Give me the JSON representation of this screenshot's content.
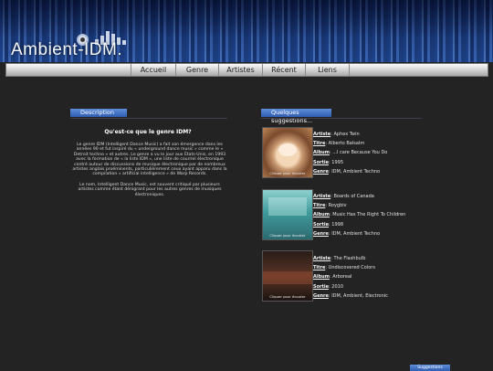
{
  "site": {
    "logo_text": "Ambient-IDM."
  },
  "nav": {
    "items": [
      "Accueil",
      "Genre",
      "Artistes",
      "Récent",
      "Liens"
    ]
  },
  "description": {
    "header": "Description",
    "question": "Qu'est-ce que le genre IDM?",
    "paragraphs": [
      "Le genre IDM (Intelligent Dance Music) a fait son émergence dans les années 90 et fut inspiré du « underground dance music » comme le « Detroit techno » et autres. Le genre a vu le jour aux États-Unis, en 1993 avec la formation de « la liste IDM », une liste de courriel électronique centré autour de discussions de musique électronique par de nombreux artistes anglais proéminents, particulièrement ceux ayant apparu dans la compilation « artificial intelligence » de Warp Records.",
      "Le nom, Intelligent Dance Music, est souvent critiqué par plusieurs artistes comme étant dénigrant pour les autres genres de musiques électroniques."
    ]
  },
  "suggestions": {
    "header": "Quelques suggestions...",
    "labels": {
      "artist": "Artiste",
      "title": "Titre",
      "album": "Album",
      "year": "Sortie",
      "genre": "Genre"
    },
    "items": [
      {
        "artist": "Aphex Twin",
        "title": "Alberto Balsalm",
        "album": "...I care Because You Do",
        "year": "1995",
        "genre": "IDM, Ambient Techno",
        "cover_caption": "Cliquer pour écouter"
      },
      {
        "artist": "Boards of Canada",
        "title": "Roygbiv",
        "album": "Music Has The Right To Children",
        "year": "1998",
        "genre": "IDM, Ambient Techno",
        "cover_caption": "Cliquer pour écouter"
      },
      {
        "artist": "The Flashbulb",
        "title": "Undiscovered Colors",
        "album": "Arboreal",
        "year": "2010",
        "genre": "IDM, Ambient, Electronic",
        "cover_caption": "Cliquer pour écouter"
      }
    ],
    "button": "Suggestions"
  }
}
